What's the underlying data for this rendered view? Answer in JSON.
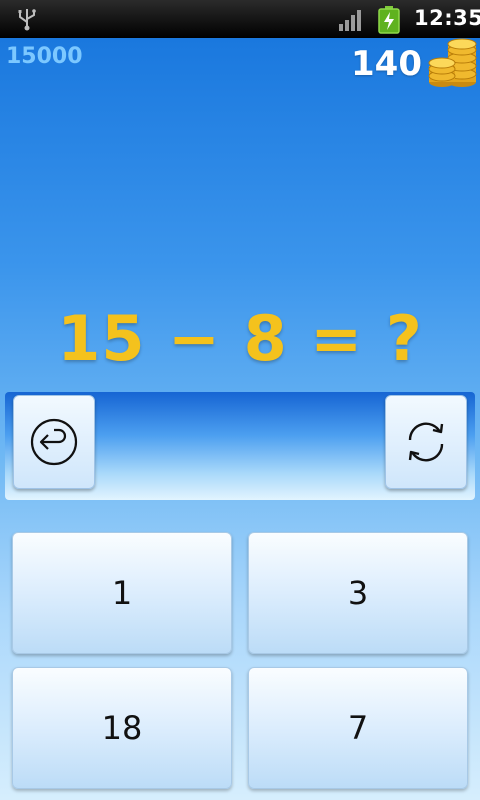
{
  "status_bar": {
    "time": "12:35",
    "icons": [
      "usb-icon",
      "signal-icon",
      "battery-charging-icon"
    ]
  },
  "game": {
    "score": "15000",
    "coins": "140",
    "coin_icon": "coin-stack-icon",
    "question": "15 − 8 = ?",
    "question_color": "#f4c21d",
    "back_icon": "undo-icon",
    "refresh_icon": "refresh-icon",
    "options": [
      "1",
      "3",
      "18",
      "7"
    ]
  }
}
